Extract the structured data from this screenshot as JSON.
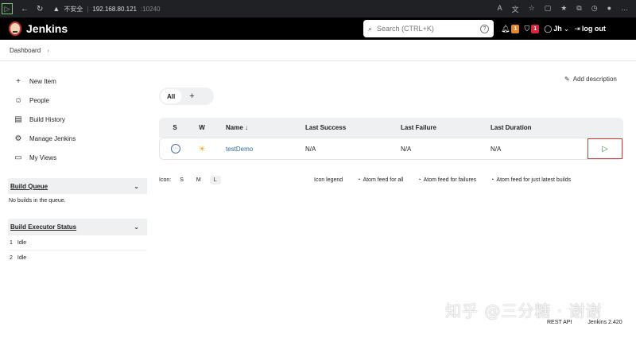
{
  "browser": {
    "security_label": "不安全",
    "host": "192.168.80.121",
    "port": ":10240"
  },
  "header": {
    "app_name": "Jenkins",
    "search_placeholder": "Search (CTRL+K)",
    "notifications_count": "1",
    "security_count": "1",
    "user": "Jh",
    "logout_label": "log out"
  },
  "breadcrumb": {
    "items": [
      "Dashboard"
    ]
  },
  "sidebar": {
    "tasks": [
      {
        "label": "New Item",
        "icon": "plus-icon"
      },
      {
        "label": "People",
        "icon": "people-icon"
      },
      {
        "label": "Build History",
        "icon": "notepad-icon"
      },
      {
        "label": "Manage Jenkins",
        "icon": "gear-icon"
      },
      {
        "label": "My Views",
        "icon": "folder-icon"
      }
    ],
    "build_queue": {
      "title": "Build Queue",
      "empty_text": "No builds in the queue."
    },
    "executor_status": {
      "title": "Build Executor Status",
      "executors": [
        {
          "num": "1",
          "state": "Idle"
        },
        {
          "num": "2",
          "state": "Idle"
        }
      ]
    }
  },
  "main": {
    "add_description": "Add description",
    "view_tabs": {
      "active": "All"
    },
    "table": {
      "headers": [
        "S",
        "W",
        "Name ↓",
        "Last Success",
        "Last Failure",
        "Last Duration"
      ],
      "rows": [
        {
          "name": "testDemo",
          "last_success": "N/A",
          "last_failure": "N/A",
          "last_duration": "N/A"
        }
      ]
    },
    "icon_size": {
      "label": "Icon:",
      "options": [
        "S",
        "M",
        "L"
      ],
      "active": "L"
    },
    "feeds": {
      "legend": "Icon legend",
      "all": "Atom feed for all",
      "failures": "Atom feed for failures",
      "latest": "Atom feed for just latest builds"
    }
  },
  "footer": {
    "rest_api": "REST API",
    "version": "Jenkins 2.420"
  },
  "watermark": "知乎 @三分糖 · 谢谢",
  "colors": {
    "header_bg": "#000000",
    "accent_link": "#2d6a9f",
    "badge_orange": "#e8852a",
    "badge_red": "#d9263f",
    "build_play": "#2a9d4b"
  }
}
